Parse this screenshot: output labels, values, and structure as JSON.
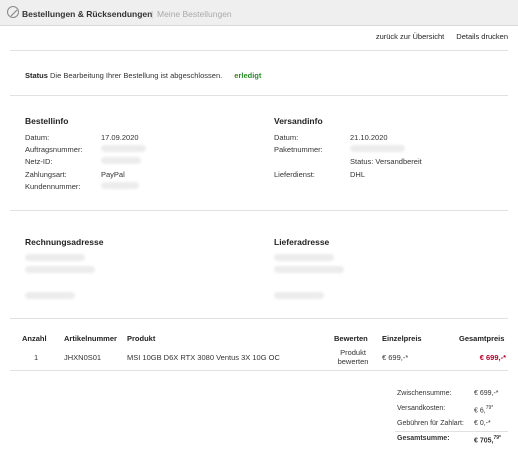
{
  "header": {
    "title": "Bestellungen & Rücksendungen",
    "separator": "|",
    "breadcrumb": "Meine Bestellungen"
  },
  "actions": {
    "back": "zurück zur Übersicht",
    "print": "Details drucken"
  },
  "status": {
    "label": "Status",
    "text": "Die Bearbeitung Ihrer Bestellung ist abgeschlossen.",
    "badge": "erledigt"
  },
  "order_info": {
    "title": "Bestellinfo",
    "date_label": "Datum:",
    "date": "17.09.2020",
    "order_no_label": "Auftragsnummer:",
    "net_id_label": "Netz-ID:",
    "payment_label": "Zahlungsart:",
    "payment": "PayPal",
    "customer_no_label": "Kundennummer:"
  },
  "shipping_info": {
    "title": "Versandinfo",
    "date_label": "Datum:",
    "date": "21.10.2020",
    "package_label": "Paketnummer:",
    "status_text": "Status: Versandbereit",
    "carrier_label": "Lieferdienst:",
    "carrier": "DHL"
  },
  "billing_address": {
    "title": "Rechnungsadresse"
  },
  "delivery_address": {
    "title": "Lieferadresse"
  },
  "table": {
    "headers": [
      "Anzahl",
      "Artikelnummer",
      "Produkt",
      "Bewerten",
      "Einzelpreis",
      "Gesamtpreis"
    ],
    "rows": [
      {
        "qty": "1",
        "sku": "JHXN0S01",
        "product": "MSI 10GB D6X RTX 3080 Ventus 3X 10G OC",
        "rate_line1": "Produkt",
        "rate_line2": "bewerten",
        "unit": "€ 699,-*",
        "total": "€ 699,-*"
      }
    ]
  },
  "summary": {
    "subtotal_label": "Zwischensumme:",
    "subtotal": "€ 699,-*",
    "shipping_label": "Versandkosten:",
    "shipping_main": "€ 6,",
    "shipping_cents": "79*",
    "fees_label": "Gebühren für Zahlart:",
    "fees": "€ 0,-*",
    "total_label": "Gesamtsumme:",
    "total_main": "€ 705,",
    "total_cents": "79*"
  },
  "colors": {
    "accent_red": "#b3002d",
    "status_green": "#2b8a2b"
  }
}
